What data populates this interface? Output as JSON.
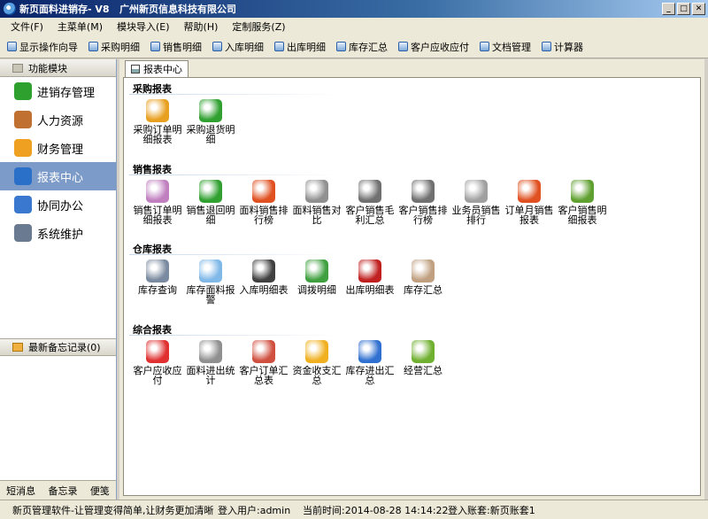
{
  "window": {
    "title": "新页面料进销存- V8   广州新页信息科技有限公司",
    "controls": [
      "_",
      "□",
      "✕"
    ]
  },
  "menu": [
    "文件(F)",
    "主菜单(M)",
    "模块导入(E)",
    "帮助(H)",
    "定制服务(Z)"
  ],
  "toolbar": [
    "显示操作向导",
    "采购明细",
    "销售明细",
    "入库明细",
    "出库明细",
    "库存汇总",
    "客户应收应付",
    "文档管理",
    "计算器"
  ],
  "sidebar": {
    "header": "功能模块",
    "modules": [
      {
        "label": "进销存管理",
        "icon": "check-circle-icon",
        "color": "#2ea02e"
      },
      {
        "label": "人力资源",
        "icon": "people-icon",
        "color": "#c07030"
      },
      {
        "label": "财务管理",
        "icon": "folder-icon",
        "color": "#f0a020"
      },
      {
        "label": "报表中心",
        "icon": "report-icon",
        "color": "#2a70c8"
      },
      {
        "label": "协同办公",
        "icon": "calendar-icon",
        "color": "#3a78d0"
      },
      {
        "label": "系统维护",
        "icon": "lock-icon",
        "color": "#6a7a90"
      }
    ],
    "memo_header": "最新备忘记录(0)",
    "bottom_links": [
      "短消息",
      "备忘录",
      "便笺"
    ]
  },
  "main": {
    "tab": "报表中心",
    "sections": [
      {
        "title": "采购报表",
        "items": [
          {
            "label": "采购订单明细报表",
            "icon": "cart-icon",
            "color": "#e8a020"
          },
          {
            "label": "采购退货明细",
            "icon": "return-icon",
            "color": "#30a030"
          }
        ]
      },
      {
        "title": "销售报表",
        "items": [
          {
            "label": "销售订单明细报表",
            "icon": "discount-icon",
            "color": "#c080c0"
          },
          {
            "label": "销售退回明细",
            "icon": "return-icon",
            "color": "#30a030"
          },
          {
            "label": "面料销售排行榜",
            "icon": "bar-chart-icon",
            "color": "#e05020"
          },
          {
            "label": "面料销售对比",
            "icon": "document-icon",
            "color": "#909090"
          },
          {
            "label": "客户销售毛利汇总",
            "icon": "dollar-icon",
            "color": "#707070"
          },
          {
            "label": "客户销售排行榜",
            "icon": "dollar-icon",
            "color": "#707070"
          },
          {
            "label": "业务员销售排行",
            "icon": "bar-chart-icon",
            "color": "#a0a0a0"
          },
          {
            "label": "订单月销售报表",
            "icon": "bar-chart-icon",
            "color": "#e05020"
          },
          {
            "label": "客户销售明细报表",
            "icon": "clock-icon",
            "color": "#60a030"
          }
        ]
      },
      {
        "title": "仓库报表",
        "items": [
          {
            "label": "库存查询",
            "icon": "search-icon",
            "color": "#7a8aa0"
          },
          {
            "label": "库存面料报警",
            "icon": "folder-icon",
            "color": "#80b8e8"
          },
          {
            "label": "入库明细表",
            "icon": "cart-add-icon",
            "color": "#404040"
          },
          {
            "label": "调拨明细",
            "icon": "refresh-icon",
            "color": "#40a040"
          },
          {
            "label": "出库明细表",
            "icon": "cart-remove-icon",
            "color": "#c02020"
          },
          {
            "label": "库存汇总",
            "icon": "box-icon",
            "color": "#c0a080"
          }
        ]
      },
      {
        "title": "综合报表",
        "items": [
          {
            "label": "客户应收应付",
            "icon": "money-icon",
            "color": "#e03030"
          },
          {
            "label": "面料进出统计",
            "icon": "document-icon",
            "color": "#909090"
          },
          {
            "label": "客户订单汇总表",
            "icon": "calendar-icon",
            "color": "#d05040"
          },
          {
            "label": "资金收支汇总",
            "icon": "coins-icon",
            "color": "#f0b020"
          },
          {
            "label": "库存进出汇总",
            "icon": "database-icon",
            "color": "#3070d0"
          },
          {
            "label": "经营汇总",
            "icon": "wallet-icon",
            "color": "#70b030"
          }
        ]
      }
    ]
  },
  "status": {
    "slogan": "新页管理软件-让管理变得简单,让财务更加清晰",
    "user": "登入用户:admin",
    "time": "当前时间:2014-08-28 14:14:22",
    "account": "登入账套:新页账套1"
  }
}
